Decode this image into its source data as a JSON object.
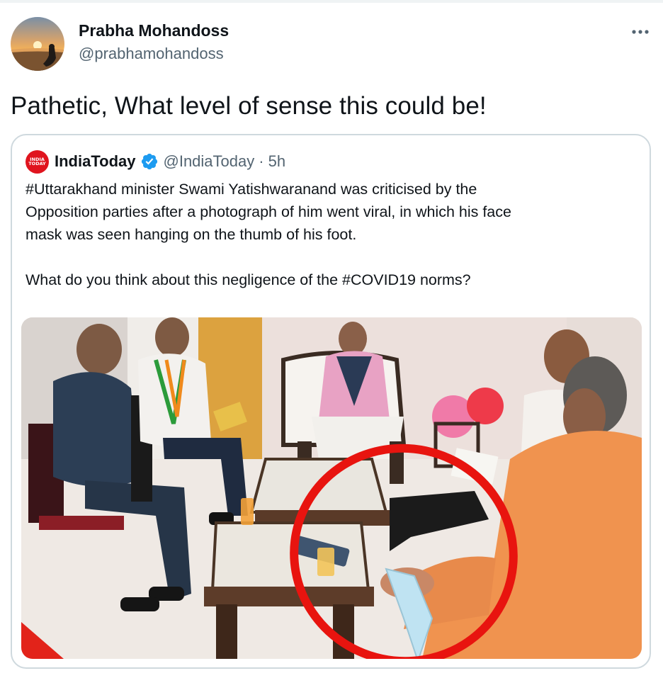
{
  "tweet": {
    "author": {
      "name": "Prabha Mohandoss",
      "handle": "@prabhamohandoss",
      "avatar_icon": "sunset-silhouette-avatar"
    },
    "more_icon": "more-horizontal-icon",
    "text": "Pathetic, What level of sense this could be!"
  },
  "quoted_tweet": {
    "account": {
      "logo_text_top": "INDIA",
      "logo_text_bottom": "TODAY",
      "name": "IndiaToday",
      "verified_icon": "verified-badge-icon",
      "handle": "@IndiaToday",
      "separator": "·",
      "time": "5h"
    },
    "text_lines": [
      "#Uttarakhand minister Swami Yatishwaranand was criticised by the",
      "Opposition parties after a photograph of him went viral, in which his face",
      "mask was seen hanging on the thumb of his foot."
    ],
    "question": "What do you think about this negligence of the #COVID19 norms?",
    "photo_icon": "news-photo-meeting-room",
    "colors": {
      "brand_red": "#e0141e",
      "verified_blue": "#1d9bf0",
      "highlight_circle": "#e8140f",
      "secondary_text": "#536471",
      "card_border": "#cfd9de"
    }
  }
}
